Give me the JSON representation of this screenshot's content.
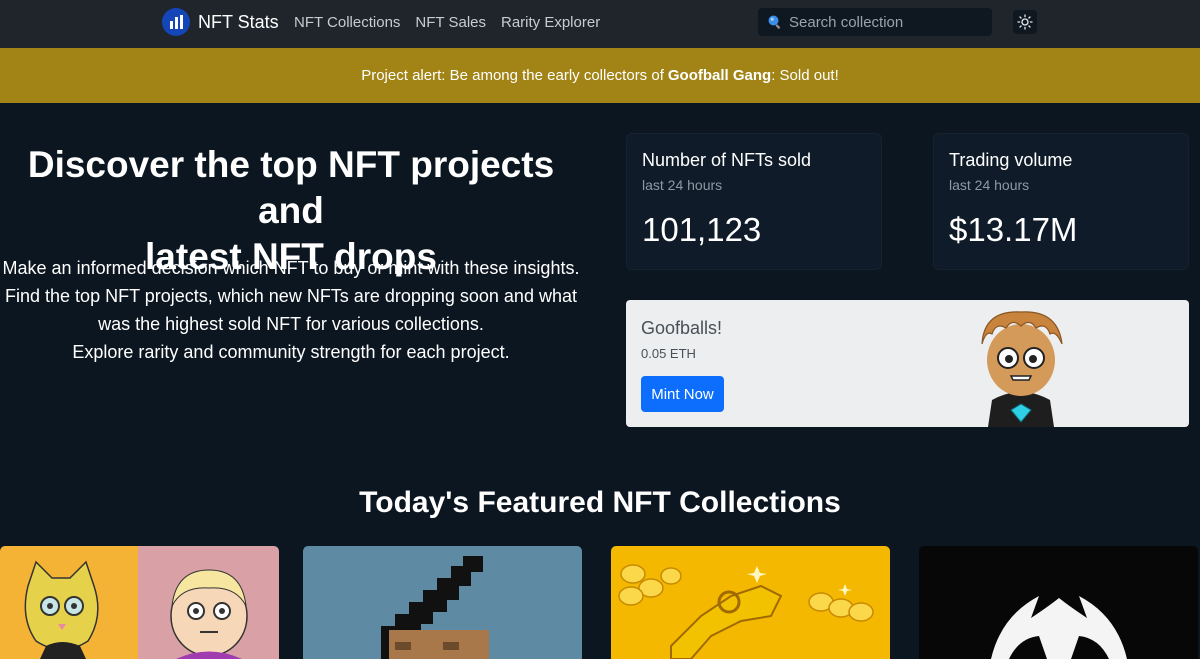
{
  "nav": {
    "brand": "NFT Stats",
    "links": [
      "NFT Collections",
      "NFT Sales",
      "Rarity Explorer"
    ],
    "search_placeholder": "Search collection"
  },
  "alert": {
    "prefix": "Project alert: Be among the early collectors of",
    "project": "Goofball Gang",
    "suffix": ": Sold out!"
  },
  "hero": {
    "title_line1": "Discover the top NFT projects and",
    "title_line2": "latest NFT drops",
    "lines": [
      "Make an informed decision which NFT to buy or mint with these insights.",
      "Find the top NFT projects, which new NFTs are dropping soon and what",
      "was the highest sold NFT for various collections.",
      "Explore rarity and community strength for each project."
    ]
  },
  "stats": [
    {
      "title": "Number of NFTs sold",
      "subtitle": "last 24 hours",
      "value": "101,123"
    },
    {
      "title": "Trading volume",
      "subtitle": "last 24 hours",
      "value": "$13.17M"
    }
  ],
  "mint": {
    "name": "Goofballs!",
    "price": "0.05 ETH",
    "button": "Mint Now"
  },
  "featured": {
    "title": "Today's Featured NFT Collections"
  },
  "colors": {
    "background": "#0c1620",
    "navbar": "#1f252b",
    "alert": "#a18415",
    "primary_button": "#0d6efd"
  }
}
